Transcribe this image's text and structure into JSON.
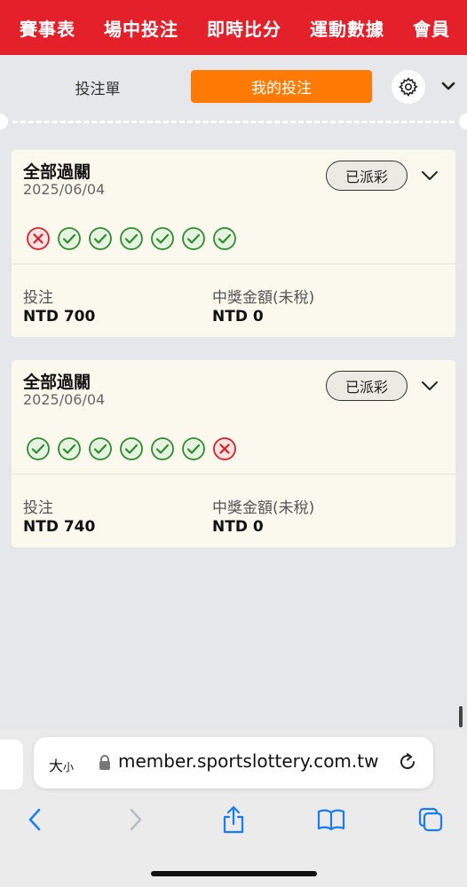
{
  "top_nav": {
    "tabs": [
      "賽事表",
      "場中投注",
      "即時比分",
      "運動數據",
      "會員"
    ]
  },
  "bet_panel": {
    "tab_betslip": "投注單",
    "tab_my_bets": "我的投注",
    "icons": {
      "settings": "gear-icon",
      "collapse": "chevron-down-icon"
    }
  },
  "bets": [
    {
      "title": "全部過關",
      "date": "2025/06/04",
      "status": "已派彩",
      "legs": [
        "lost",
        "won",
        "won",
        "won",
        "won",
        "won",
        "won"
      ],
      "stake_label": "投注",
      "stake_value": "NTD 700",
      "winnings_label": "中獎金額(未稅)",
      "winnings_value": "NTD 0"
    },
    {
      "title": "全部過關",
      "date": "2025/06/04",
      "status": "已派彩",
      "legs": [
        "won",
        "won",
        "won",
        "won",
        "won",
        "won",
        "lost"
      ],
      "stake_label": "投注",
      "stake_value": "NTD 740",
      "winnings_label": "中獎金額(未稅)",
      "winnings_value": "NTD 0"
    }
  ],
  "browser": {
    "text_size_big": "大",
    "text_size_small": "小",
    "url": "member.sportslottery.com.tw",
    "toolbar_icons": [
      "back-icon",
      "forward-icon",
      "share-icon",
      "bookmarks-icon",
      "tabs-icon"
    ]
  },
  "colors": {
    "nav_red": "#e4212b",
    "accent_orange": "#ff7a05",
    "won_green": "#2e8b2e",
    "lost_red": "#d8202a"
  }
}
